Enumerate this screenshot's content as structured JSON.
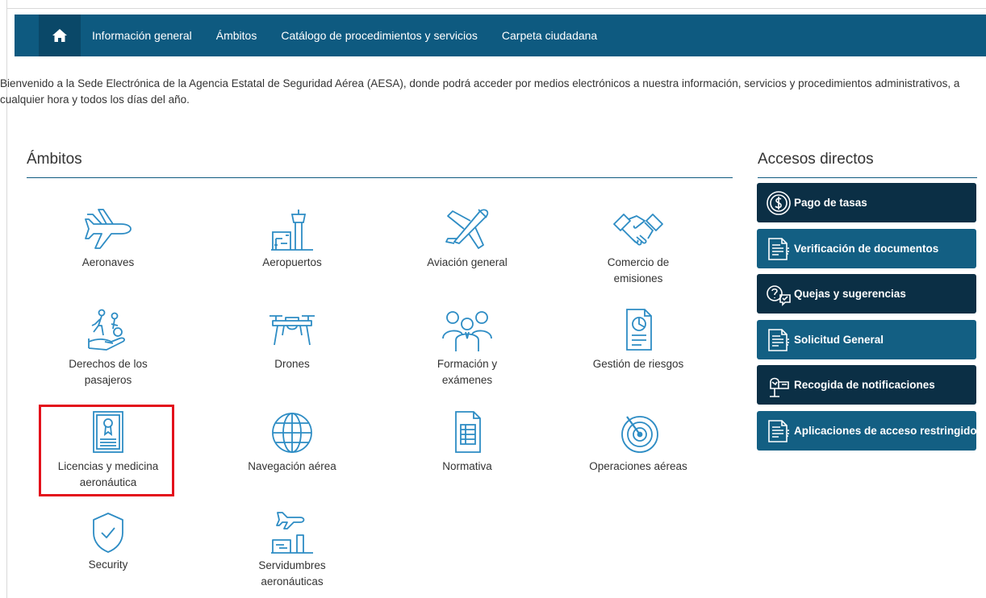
{
  "nav": {
    "home_icon": "home-icon",
    "items": [
      "Información general",
      "Ámbitos",
      "Catálogo de procedimientos y servicios",
      "Carpeta ciudadana"
    ]
  },
  "intro": "Bienvenido a la Sede Electrónica de la Agencia Estatal de Seguridad Aérea (AESA), donde podrá acceder por medios electrónicos a nuestra información, servicios y procedimientos administrativos, a cualquier hora y todos los días del año.",
  "ambitos": {
    "title": "Ámbitos",
    "items": [
      {
        "label1": "Aeronaves",
        "label2": "",
        "icon": "airplane-icon"
      },
      {
        "label1": "Aeropuertos",
        "label2": "",
        "icon": "airport-tower-icon"
      },
      {
        "label1": "Aviación general",
        "label2": "",
        "icon": "light-aircraft-icon"
      },
      {
        "label1": "Comercio de",
        "label2": "emisiones",
        "icon": "handshake-icon"
      },
      {
        "label1": "Derechos de los",
        "label2": "pasajeros",
        "icon": "passengers-hand-icon"
      },
      {
        "label1": "Drones",
        "label2": "",
        "icon": "drone-icon"
      },
      {
        "label1": "Formación y",
        "label2": "exámenes",
        "icon": "people-group-icon"
      },
      {
        "label1": "Gestión de riesgos",
        "label2": "",
        "icon": "risk-document-icon"
      },
      {
        "label1": "Licencias y medicina",
        "label2": "aeronáutica",
        "icon": "license-card-icon"
      },
      {
        "label1": "Navegación aérea",
        "label2": "",
        "icon": "globe-icon"
      },
      {
        "label1": "Normativa",
        "label2": "",
        "icon": "document-list-icon"
      },
      {
        "label1": "Operaciones aéreas",
        "label2": "",
        "icon": "radar-icon"
      },
      {
        "label1": "Security",
        "label2": "",
        "icon": "shield-check-icon"
      },
      {
        "label1": "Servidumbres",
        "label2": "aeronáuticas",
        "icon": "airport-easement-icon"
      }
    ]
  },
  "accesos": {
    "title": "Accesos directos",
    "items": [
      {
        "label": "Pago de tasas",
        "icon": "dollar-coin-icon",
        "style": "dark"
      },
      {
        "label": "Verificación de documentos",
        "icon": "document-check-icon",
        "style": "mid"
      },
      {
        "label": "Quejas y sugerencias",
        "icon": "speech-question-icon",
        "style": "dark"
      },
      {
        "label": "Solicitud General",
        "icon": "document-form-icon",
        "style": "mid"
      },
      {
        "label": "Recogida de notificaciones",
        "icon": "mailbox-icon",
        "style": "dark"
      },
      {
        "label": "Aplicaciones de acceso restringido",
        "icon": "document-lock-icon",
        "style": "mid"
      }
    ]
  },
  "colors": {
    "nav_bg": "#0e5a80",
    "icon_blue": "#2d8cc4",
    "highlight": "#e3101b",
    "btn_dark": "#0b2f45",
    "btn_mid": "#135f83"
  }
}
